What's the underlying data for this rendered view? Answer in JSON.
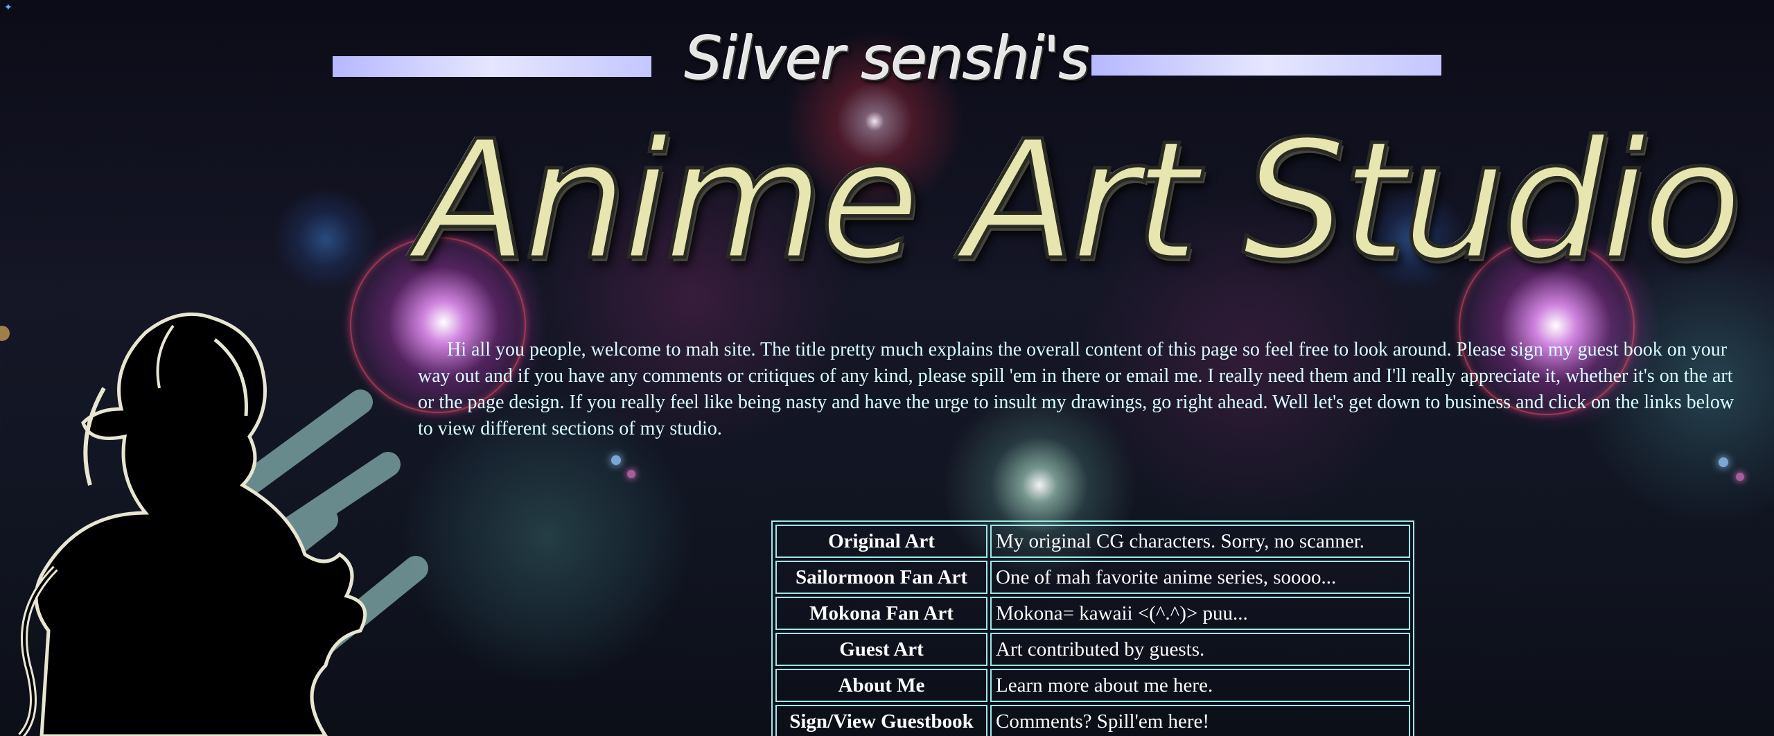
{
  "header": {
    "subtitle": "Silver senshi's",
    "title": "Anime Art Studio"
  },
  "intro": {
    "text": "Hi all you people, welcome to mah site. The title pretty much explains the overall content of this page so feel free to look around. Please sign my guest book on your way out and if you have any comments or critiques of any kind, please spill 'em in there or email me. I really need them and I'll really appreciate it, whether it's on the art or the page design. If you really feel like being nasty and have the urge to insult my drawings, go right ahead. Well let's get down to business and click on the links below to view different sections of my studio."
  },
  "nav": {
    "rows": [
      {
        "label": "Original Art",
        "description": "My original CG characters. Sorry, no scanner."
      },
      {
        "label": "Sailormoon Fan Art",
        "description": "One of mah favorite anime series, soooo..."
      },
      {
        "label": "Mokona Fan Art",
        "description": "Mokona= kawaii <(^.^)> puu..."
      },
      {
        "label": "Guest Art",
        "description": "Art contributed by guests."
      },
      {
        "label": "About Me",
        "description": "Learn more about me here."
      },
      {
        "label": "Sign/View Guestbook",
        "description": "Comments? Spill'em here!"
      }
    ]
  },
  "colors": {
    "text": "#d8ffff",
    "table_border": "#9fe8e8",
    "title_fill": "#e8e6b0",
    "bar": "#c8c8ff"
  },
  "icons": {
    "corner": "sparkle-icon"
  }
}
